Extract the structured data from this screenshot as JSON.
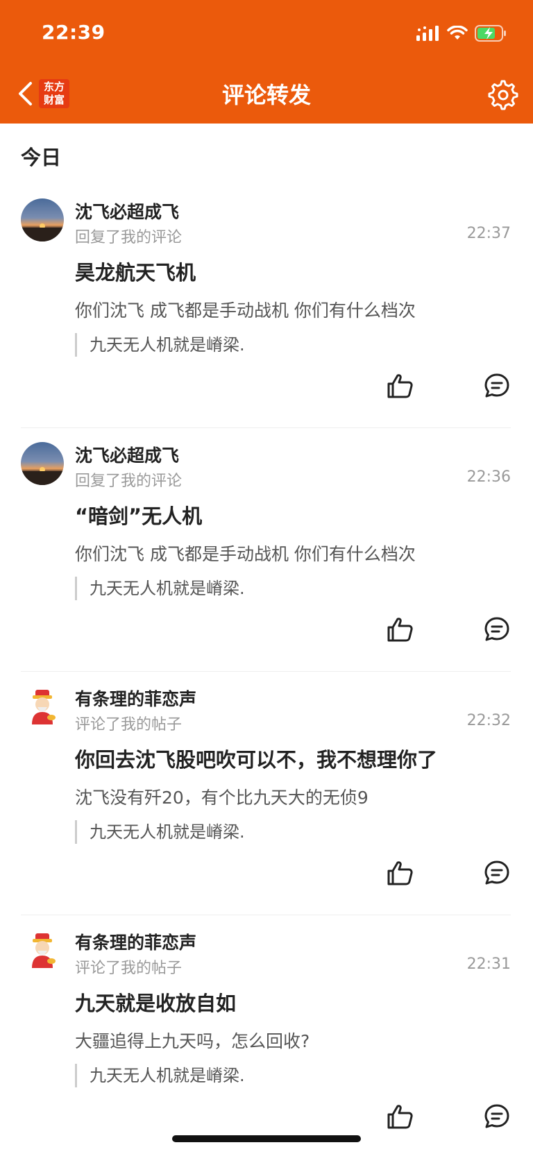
{
  "status_bar": {
    "time": "22:39"
  },
  "nav": {
    "title": "评论转发",
    "logo_line1": "东方",
    "logo_line2": "财富"
  },
  "section": {
    "label": "今日"
  },
  "notifications": [
    {
      "username": "沈飞必超成飞",
      "action": "回复了我的评论",
      "time": "22:37",
      "title": "昊龙航天飞机",
      "body": "你们沈飞 成飞都是手动战机 你们有什么档次",
      "quote": "九天无人机就是嵴梁.",
      "avatar": "sunset-avatar"
    },
    {
      "username": "沈飞必超成飞",
      "action": "回复了我的评论",
      "time": "22:36",
      "title": "“暗剑”无人机",
      "body": "你们沈飞 成飞都是手动战机 你们有什么档次",
      "quote": "九天无人机就是嵴梁.",
      "avatar": "sunset-avatar"
    },
    {
      "username": "有条理的菲恋声",
      "action": "评论了我的帖子",
      "time": "22:32",
      "title": "你回去沈飞股吧吹可以不，我不想理你了",
      "body": "沈飞没有歼20，有个比九天大的无侦9",
      "quote": "九天无人机就是嵴梁.",
      "avatar": "fortune-god-avatar"
    },
    {
      "username": "有条理的菲恋声",
      "action": "评论了我的帖子",
      "time": "22:31",
      "title": "九天就是收放自如",
      "body": "大疆追得上九天吗，怎么回收?",
      "quote": "九天无人机就是嵴梁.",
      "avatar": "fortune-god-avatar"
    }
  ],
  "colors": {
    "brand": "#eb5a0c",
    "secondary_text": "#999999"
  },
  "icons": [
    "back-arrow-icon",
    "settings-gear-icon",
    "thumbs-up-icon",
    "comment-bubble-icon",
    "signal-icon",
    "wifi-icon",
    "battery-charging-icon"
  ]
}
